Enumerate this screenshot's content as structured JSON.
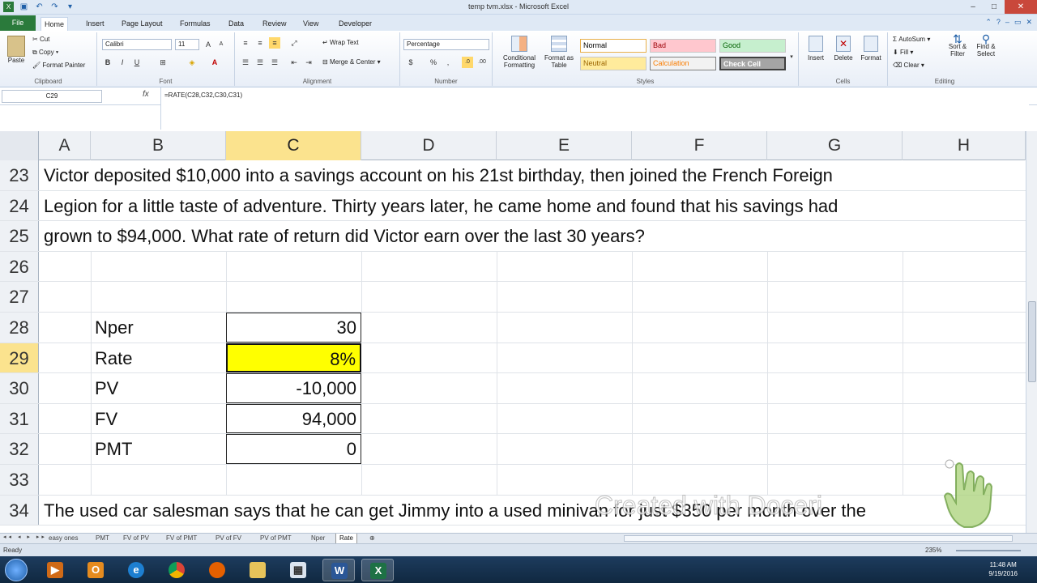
{
  "window": {
    "title": "temp tvm.xlsx - Microsoft Excel"
  },
  "ribbon": {
    "file_tab": "File",
    "tabs": [
      "Home",
      "Insert",
      "Page Layout",
      "Formulas",
      "Data",
      "Review",
      "View",
      "Developer"
    ],
    "active_tab": "Home",
    "clipboard": {
      "paste": "Paste",
      "cut": "Cut",
      "copy": "Copy",
      "format_painter": "Format Painter",
      "label": "Clipboard"
    },
    "font": {
      "family": "Calibri",
      "size": "11",
      "label": "Font",
      "bold": "B",
      "italic": "I",
      "underline": "U"
    },
    "alignment": {
      "wrap_text": "Wrap Text",
      "merge_center": "Merge & Center",
      "label": "Alignment"
    },
    "number": {
      "format": "Percentage",
      "currency": "$",
      "percent": "%",
      "comma": ",",
      "label": "Number"
    },
    "styles": {
      "conditional_formatting": "Conditional Formatting",
      "format_as_table": "Format as Table",
      "normal": "Normal",
      "bad": "Bad",
      "good": "Good",
      "neutral": "Neutral",
      "calculation": "Calculation",
      "check_cell": "Check Cell",
      "label": "Styles",
      "colors": {
        "normal_bg": "#ffffff",
        "bad_bg": "#ffc7ce",
        "bad_fg": "#9c0006",
        "good_bg": "#c6efce",
        "good_fg": "#006100",
        "neutral_bg": "#ffeb9c",
        "neutral_fg": "#9c6500",
        "calculation_bg": "#f2f2f2",
        "calculation_fg": "#fa7d00",
        "check_bg": "#a5a5a5"
      }
    },
    "cells": {
      "insert": "Insert",
      "delete": "Delete",
      "format": "Format",
      "label": "Cells"
    },
    "editing": {
      "autosum": "AutoSum",
      "fill": "Fill",
      "clear": "Clear",
      "sort_filter": "Sort & Filter",
      "find_select": "Find & Select",
      "label": "Editing"
    }
  },
  "formula_bar": {
    "name_box": "C29",
    "fx": "fx",
    "formula": "=RATE(C28,C32,C30,C31)"
  },
  "columns": [
    "A",
    "B",
    "C",
    "D",
    "E",
    "F",
    "G",
    "H"
  ],
  "selected_column": "C",
  "rows": [
    {
      "num": "23",
      "text": "Victor deposited $10,000 into a savings account on his 21st birthday, then joined the French Foreign"
    },
    {
      "num": "24",
      "text": "Legion for a little taste of adventure. Thirty years later, he came home and found that his savings had"
    },
    {
      "num": "25",
      "text": "grown to $94,000. What rate of return did Victor earn over the last 30 years?"
    },
    {
      "num": "26",
      "text": ""
    },
    {
      "num": "27",
      "text": ""
    },
    {
      "num": "28",
      "label": "Nper",
      "value": "30"
    },
    {
      "num": "29",
      "label": "Rate",
      "value": "8%",
      "active": true
    },
    {
      "num": "30",
      "label": "PV",
      "value": "-10,000"
    },
    {
      "num": "31",
      "label": "FV",
      "value": "94,000"
    },
    {
      "num": "32",
      "label": "PMT",
      "value": "0"
    },
    {
      "num": "33",
      "text": ""
    },
    {
      "num": "34",
      "text": "The used car salesman says that he can get Jimmy into a used minivan for just $350 per month over the"
    }
  ],
  "active_cell_color": "#ffff00",
  "sheets": [
    "easy ones",
    "PMT",
    "FV of PV",
    "FV of PMT",
    "PV of FV",
    "PV of PMT",
    "Nper",
    "Rate"
  ],
  "active_sheet": "Rate",
  "status": {
    "ready": "Ready",
    "zoom": "235%"
  },
  "taskbar": {
    "time": "11:48 AM",
    "date": "9/19/2016"
  },
  "watermark": "Created with Doceri"
}
